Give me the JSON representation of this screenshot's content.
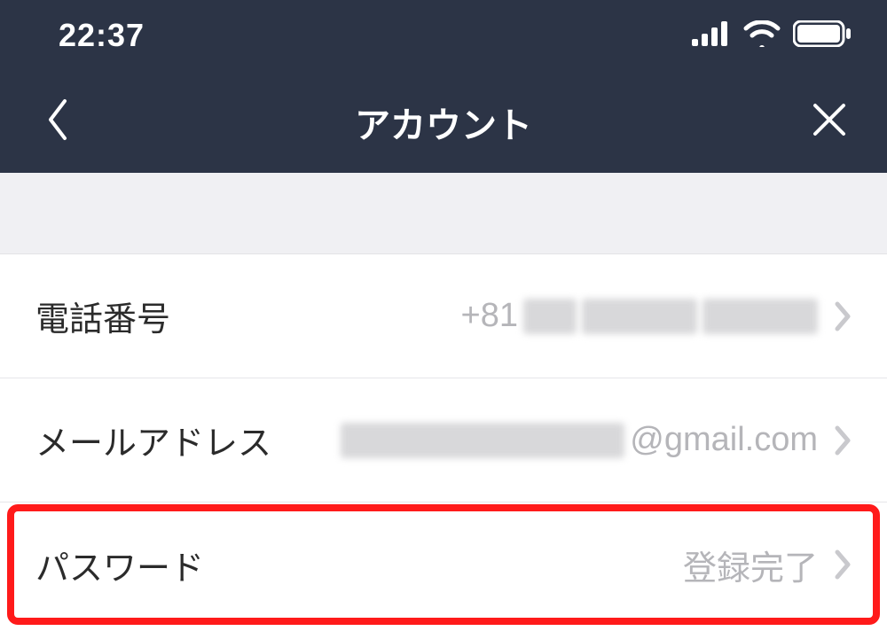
{
  "status": {
    "time": "22:37"
  },
  "nav": {
    "title": "アカウント"
  },
  "rows": {
    "phone": {
      "label": "電話番号",
      "prefix": "+81"
    },
    "email": {
      "label": "メールアドレス",
      "suffix": "@gmail.com"
    },
    "password": {
      "label": "パスワード",
      "value": "登録完了"
    }
  }
}
